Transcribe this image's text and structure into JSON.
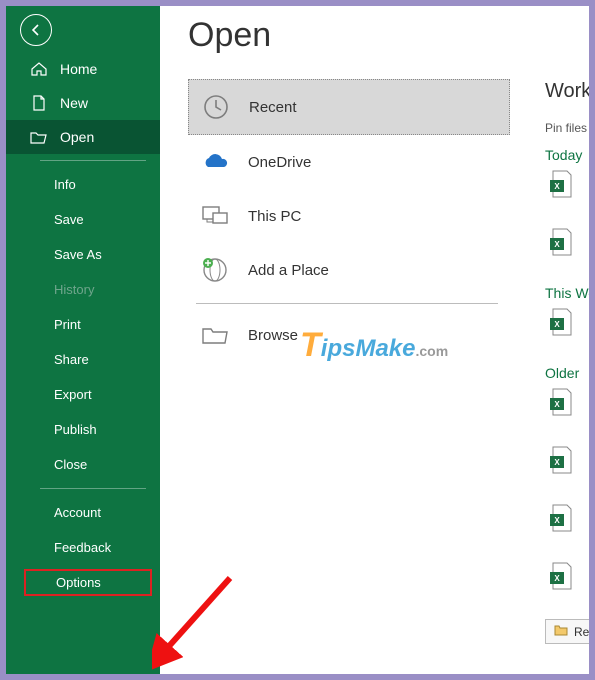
{
  "page_title": "Open",
  "sidebar": {
    "nav": [
      {
        "label": "Home"
      },
      {
        "label": "New"
      },
      {
        "label": "Open"
      }
    ],
    "subs": [
      "Info",
      "Save",
      "Save As",
      "History",
      "Print",
      "Share",
      "Export",
      "Publish",
      "Close"
    ],
    "footer": [
      "Account",
      "Feedback",
      "Options"
    ]
  },
  "locations": [
    "Recent",
    "OneDrive",
    "This PC",
    "Add a Place",
    "Browse"
  ],
  "right": {
    "heading": "Workbooks",
    "pin_text": "Pin files you want",
    "groups": [
      "Today",
      "This Week",
      "Older"
    ],
    "recover_label": "Recover"
  },
  "watermark": {
    "t": "T",
    "rest": "ipsMake",
    "com": ".com"
  }
}
